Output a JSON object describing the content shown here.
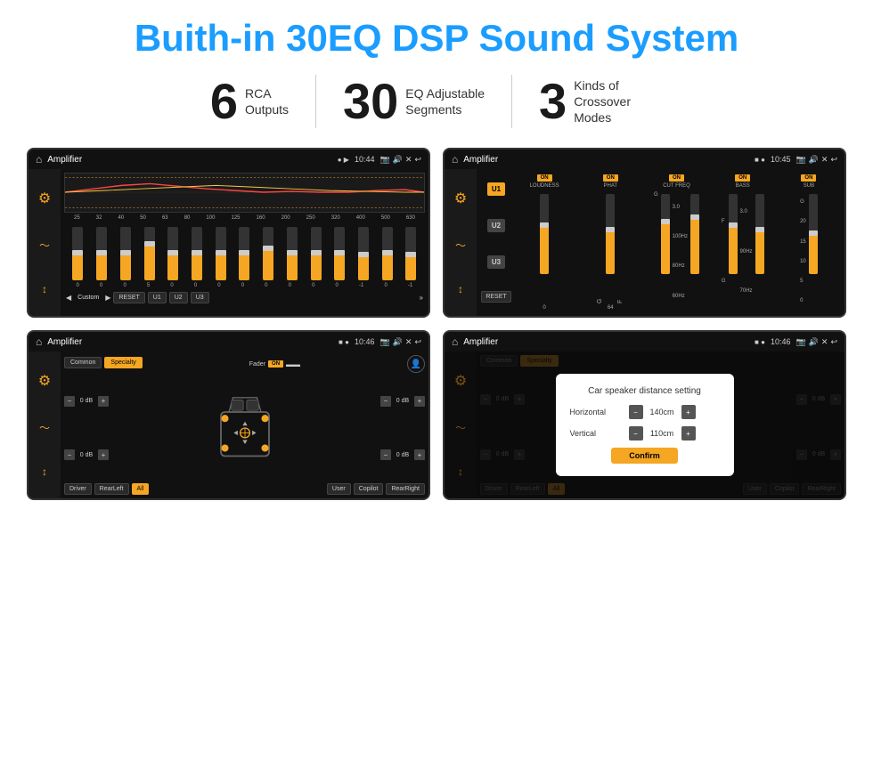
{
  "header": {
    "title": "Buith-in 30EQ DSP Sound System"
  },
  "stats": [
    {
      "number": "6",
      "label": "RCA\nOutputs"
    },
    {
      "number": "30",
      "label": "EQ Adjustable\nSegments"
    },
    {
      "number": "3",
      "label": "Kinds of\nCrossover Modes"
    }
  ],
  "screens": {
    "eq": {
      "title": "Amplifier",
      "time": "10:44",
      "frequencies": [
        "25",
        "32",
        "40",
        "50",
        "63",
        "80",
        "100",
        "125",
        "160",
        "200",
        "250",
        "320",
        "400",
        "500",
        "630"
      ],
      "values": [
        "0",
        "0",
        "0",
        "5",
        "0",
        "0",
        "0",
        "0",
        "0",
        "0",
        "0",
        "0",
        "-1",
        "0",
        "-1"
      ],
      "buttons": [
        "Custom",
        "RESET",
        "U1",
        "U2",
        "U3"
      ]
    },
    "crossover": {
      "title": "Amplifier",
      "time": "10:45",
      "groups": [
        "LOUDNESS",
        "PHAT",
        "CUT FREQ",
        "BASS",
        "SUB"
      ],
      "uButtons": [
        "U1",
        "U2",
        "U3"
      ]
    },
    "speaker": {
      "title": "Amplifier",
      "time": "10:46",
      "tabs": [
        "Common",
        "Specialty"
      ],
      "faderLabel": "Fader",
      "values": [
        "0 dB",
        "0 dB",
        "0 dB",
        "0 dB"
      ],
      "bottomBtns": [
        "Driver",
        "RearLeft",
        "All",
        "User",
        "Copilot",
        "RearRight"
      ]
    },
    "dialog": {
      "title": "Amplifier",
      "time": "10:46",
      "tabs": [
        "Common",
        "Specialty"
      ],
      "dialogTitle": "Car speaker distance setting",
      "horizontal": {
        "label": "Horizontal",
        "value": "140cm"
      },
      "vertical": {
        "label": "Vertical",
        "value": "110cm"
      },
      "confirmBtn": "Confirm",
      "values": [
        "0 dB",
        "0 dB"
      ],
      "bottomBtns": [
        "Driver",
        "RearLeft",
        "All",
        "User",
        "Copilot",
        "RearRight"
      ]
    }
  }
}
